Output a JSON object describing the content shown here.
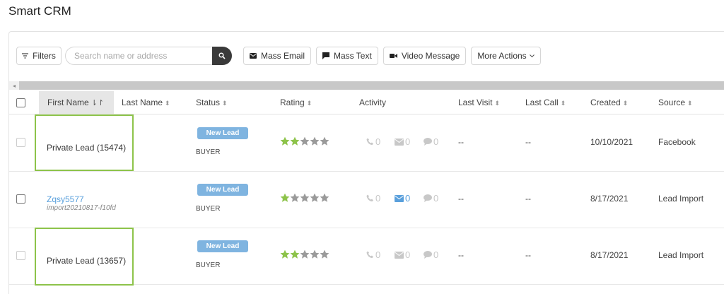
{
  "app": {
    "title": "Smart CRM"
  },
  "toolbar": {
    "filters_label": "Filters",
    "search_placeholder": "Search name or address",
    "mass_email_label": "Mass Email",
    "mass_text_label": "Mass Text",
    "video_message_label": "Video Message",
    "more_actions_label": "More Actions"
  },
  "table": {
    "columns": {
      "first_name": "First Name",
      "last_name": "Last Name",
      "status": "Status",
      "rating": "Rating",
      "activity": "Activity",
      "last_visit": "Last Visit",
      "last_call": "Last Call",
      "created": "Created",
      "source": "Source"
    },
    "rows": [
      {
        "first_name": "Private Lead (15474)",
        "status_badge": "New Lead",
        "role": "BUYER",
        "rating": 2,
        "calls": "0",
        "emails": "0",
        "texts": "0",
        "last_visit": "--",
        "last_call": "--",
        "created": "10/10/2021",
        "source": "Facebook"
      },
      {
        "first_name": "Zqsy5577",
        "first_name_sub": "import20210817-f10fd",
        "status_badge": "New Lead",
        "role": "BUYER",
        "rating": 1,
        "calls": "0",
        "emails": "0",
        "texts": "0",
        "last_visit": "--",
        "last_call": "--",
        "created": "8/17/2021",
        "source": "Lead Import"
      },
      {
        "first_name": "Private Lead (13657)",
        "status_badge": "New Lead",
        "role": "BUYER",
        "rating": 2,
        "calls": "0",
        "emails": "0",
        "texts": "0",
        "last_visit": "--",
        "last_call": "--",
        "created": "8/17/2021",
        "source": "Lead Import"
      }
    ]
  },
  "colors": {
    "badge": "#7fb4e0",
    "star_filled": "#8dc34a",
    "star_empty": "#9a9a9a",
    "highlight": "#8dc34a",
    "link": "#5aa0dc"
  }
}
